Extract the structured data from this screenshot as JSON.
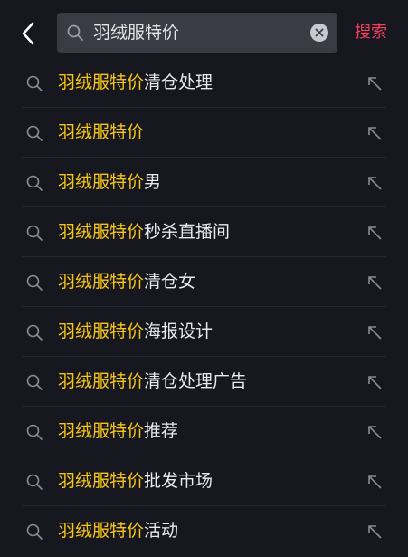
{
  "search": {
    "query": "羽绒服特价",
    "submit_label": "搜索"
  },
  "suggestions": [
    {
      "highlight": "羽绒服特价",
      "rest": "清仓处理"
    },
    {
      "highlight": "羽绒服特价",
      "rest": ""
    },
    {
      "highlight": "羽绒服特价",
      "rest": "男"
    },
    {
      "highlight": "羽绒服特价",
      "rest": "秒杀直播间"
    },
    {
      "highlight": "羽绒服特价",
      "rest": "清仓女"
    },
    {
      "highlight": "羽绒服特价",
      "rest": "海报设计"
    },
    {
      "highlight": "羽绒服特价",
      "rest": "清仓处理广告"
    },
    {
      "highlight": "羽绒服特价",
      "rest": "推荐"
    },
    {
      "highlight": "羽绒服特价",
      "rest": "批发市场"
    },
    {
      "highlight": "羽绒服特价",
      "rest": "活动"
    }
  ],
  "colors": {
    "background": "#16171f",
    "highlight": "#f5c518",
    "accent": "#f43f5e",
    "search_field": "#3a3b44"
  },
  "icons": {
    "back": "chevron-left-icon",
    "search": "search-icon",
    "clear": "clear-icon",
    "fill": "arrow-up-left-icon"
  }
}
